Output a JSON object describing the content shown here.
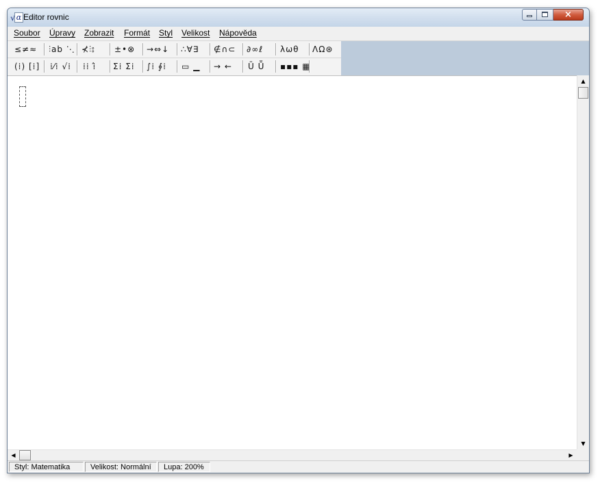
{
  "window": {
    "title": "Editor rovnic",
    "app_icon": "sqrt-alpha-icon",
    "controls": {
      "minimize": "minimize-icon",
      "maximize": "maximize-icon",
      "close": "×"
    }
  },
  "menu": [
    {
      "label": "Soubor"
    },
    {
      "label": "Úpravy"
    },
    {
      "label": "Zobrazit"
    },
    {
      "label": "Formát"
    },
    {
      "label": "Styl"
    },
    {
      "label": "Velikost"
    },
    {
      "label": "Nápověda"
    }
  ],
  "toolbar": {
    "row1": [
      "≤≠≈",
      "⫶ab ⋱",
      "⊀⫶⦂",
      "±•⊗",
      "→⇔↓",
      "∴∀∃",
      "∉∩⊂",
      "∂∞ℓ",
      "λωθ",
      "ΛΩ⊛"
    ],
    "row2": [
      "(⁞) [⁞]",
      "⁞⁄⁞ √⁞",
      "⁞⁞ ⁞̂",
      "Σ⁞ Σ⁞",
      "∫⁞ ∮⁞",
      "▭ ▁",
      "→ ←",
      "Ū Ṻ",
      "▪▪▪ ▦"
    ]
  },
  "scroll": {
    "up": "▲",
    "down": "▼",
    "left": "◀",
    "right": "▶"
  },
  "status": {
    "style": "Styl: Matematika",
    "size": "Velikost: Normální",
    "zoom": "Lupa: 200%"
  }
}
